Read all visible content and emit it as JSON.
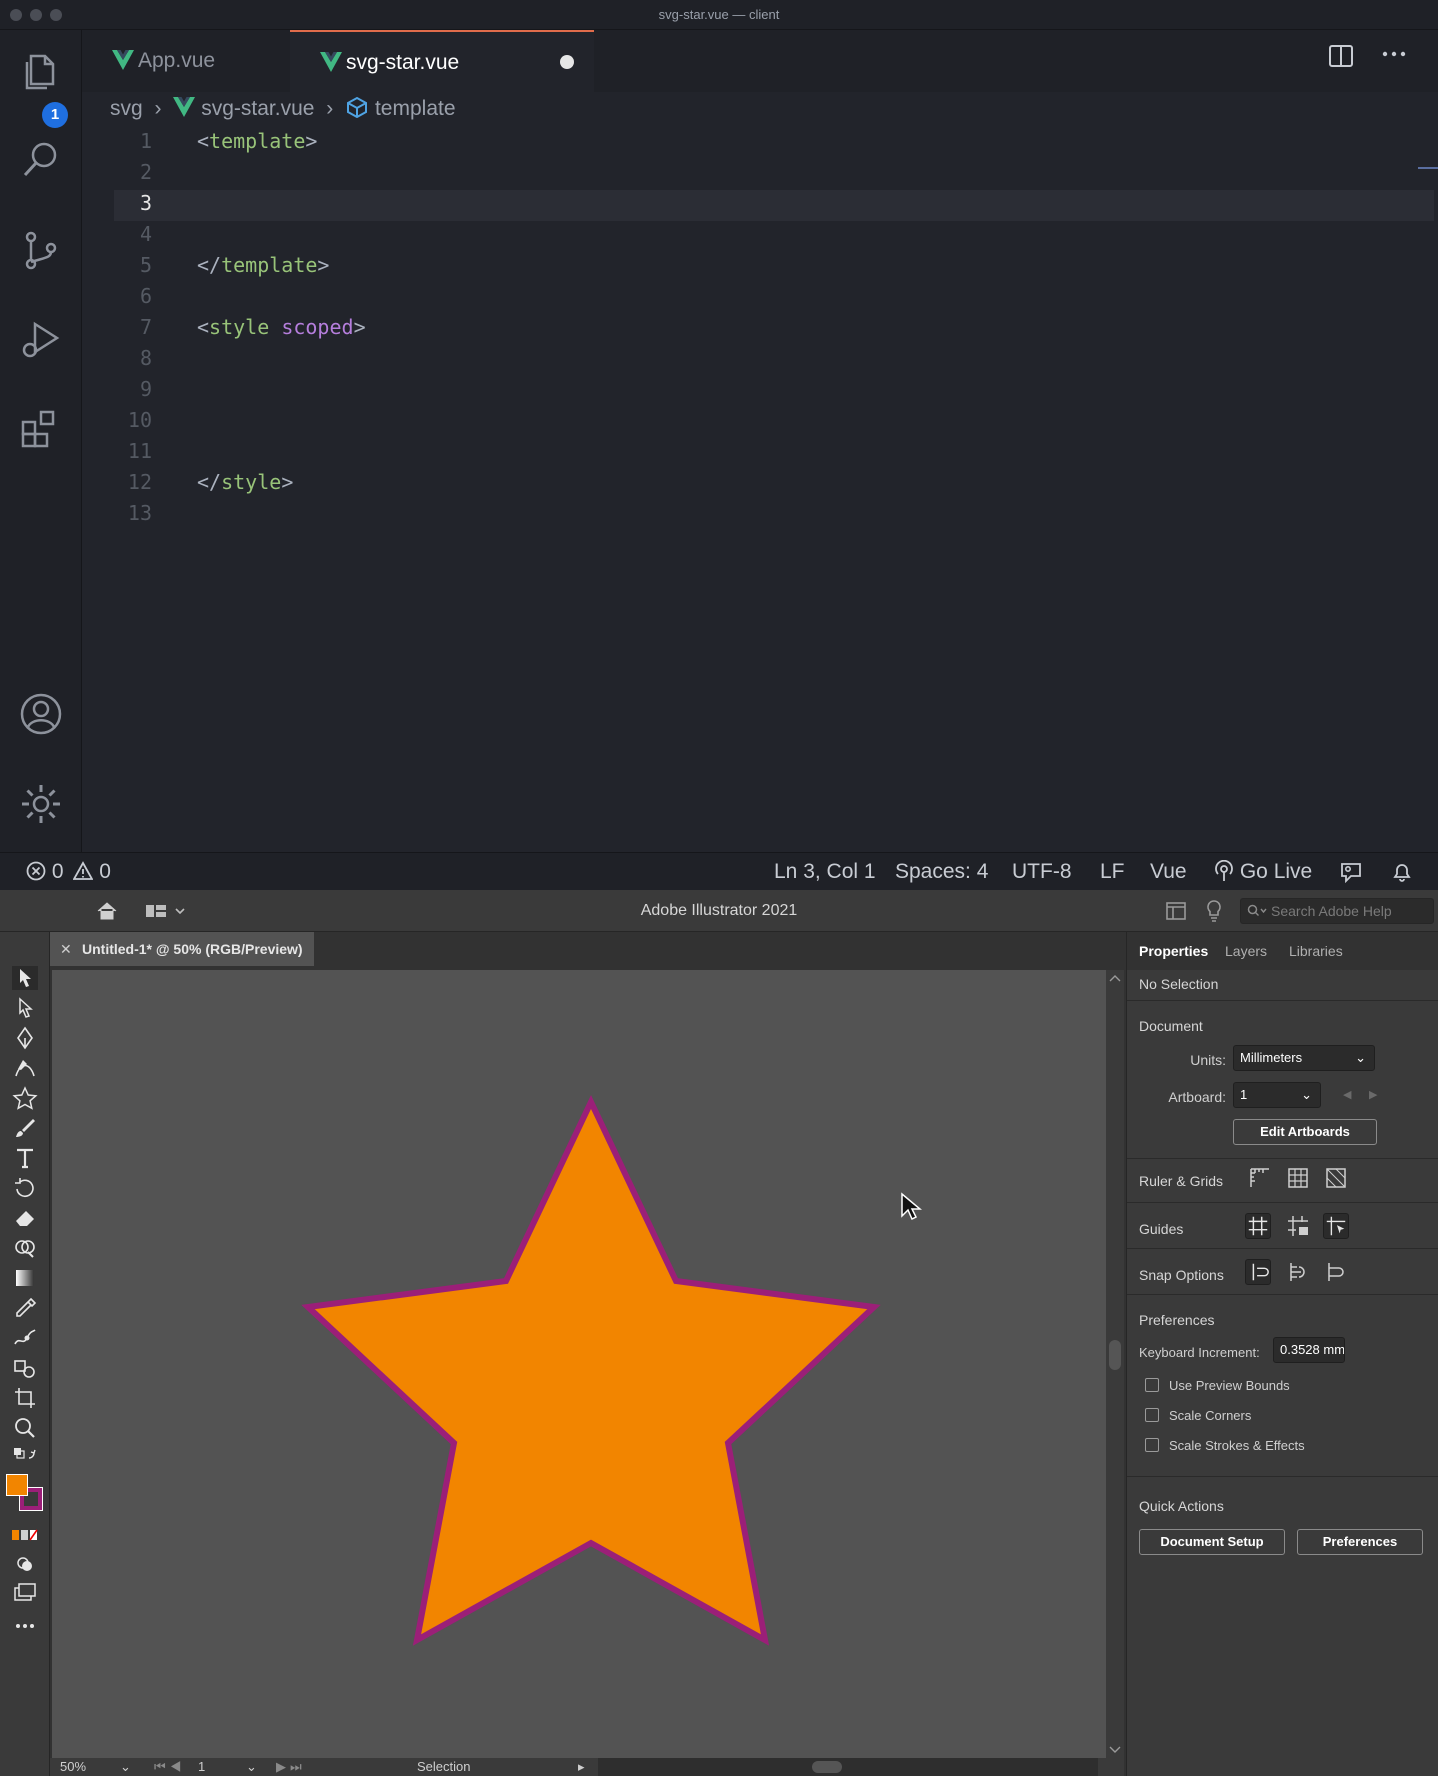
{
  "vscode": {
    "window_title": "svg-star.vue — client",
    "explorer_badge": "1",
    "tabs": [
      {
        "label": "App.vue",
        "active": false
      },
      {
        "label": "svg-star.vue",
        "active": true,
        "dirty": true
      }
    ],
    "breadcrumb": [
      "svg",
      "svg-star.vue",
      "template"
    ],
    "lines": [
      {
        "n": "1",
        "tokens": [
          [
            "p",
            "<"
          ],
          [
            "t",
            "template"
          ],
          [
            "p",
            ">"
          ]
        ]
      },
      {
        "n": "2",
        "tokens": []
      },
      {
        "n": "3",
        "tokens": []
      },
      {
        "n": "4",
        "tokens": []
      },
      {
        "n": "5",
        "tokens": [
          [
            "p",
            "</"
          ],
          [
            "t",
            "template"
          ],
          [
            "p",
            ">"
          ]
        ]
      },
      {
        "n": "6",
        "tokens": []
      },
      {
        "n": "7",
        "tokens": [
          [
            "p",
            "<"
          ],
          [
            "t",
            "style"
          ],
          [
            "p",
            " "
          ],
          [
            "a",
            "scoped"
          ],
          [
            "p",
            ">"
          ]
        ]
      },
      {
        "n": "8",
        "tokens": []
      },
      {
        "n": "9",
        "tokens": []
      },
      {
        "n": "10",
        "tokens": []
      },
      {
        "n": "11",
        "tokens": []
      },
      {
        "n": "12",
        "tokens": [
          [
            "p",
            "</"
          ],
          [
            "t",
            "style"
          ],
          [
            "p",
            ">"
          ]
        ]
      },
      {
        "n": "13",
        "tokens": []
      }
    ],
    "active_line": "3",
    "status": {
      "errors": "0",
      "warnings": "0",
      "position": "Ln 3, Col 1",
      "spaces": "Spaces: 4",
      "encoding": "UTF-8",
      "eol": "LF",
      "language": "Vue",
      "go_live": "Go Live"
    }
  },
  "illustrator": {
    "app_title": "Adobe Illustrator 2021",
    "search_placeholder": "Search Adobe Help",
    "doc_tab": "Untitled-1* @ 50% (RGB/Preview)",
    "close_glyph": "✕",
    "fill_color": "#f28500",
    "stroke_color": "#9b1f78",
    "zoom": "50%",
    "artboard_nav": "1",
    "status_tool": "Selection",
    "panel": {
      "tabs": [
        "Properties",
        "Layers",
        "Libraries"
      ],
      "selection": "No Selection",
      "document_heading": "Document",
      "units_label": "Units:",
      "units_value": "Millimeters",
      "artboard_label": "Artboard:",
      "artboard_value": "1",
      "edit_artboards": "Edit Artboards",
      "ruler_grids": "Ruler & Grids",
      "guides": "Guides",
      "snap_options": "Snap Options",
      "preferences_heading": "Preferences",
      "keyboard_increment_label": "Keyboard Increment:",
      "keyboard_increment_value": "0.3528 mm",
      "checkboxes": [
        "Use Preview Bounds",
        "Scale Corners",
        "Scale Strokes & Effects"
      ],
      "quick_actions": "Quick Actions",
      "document_setup": "Document Setup",
      "preferences_button": "Preferences"
    }
  }
}
